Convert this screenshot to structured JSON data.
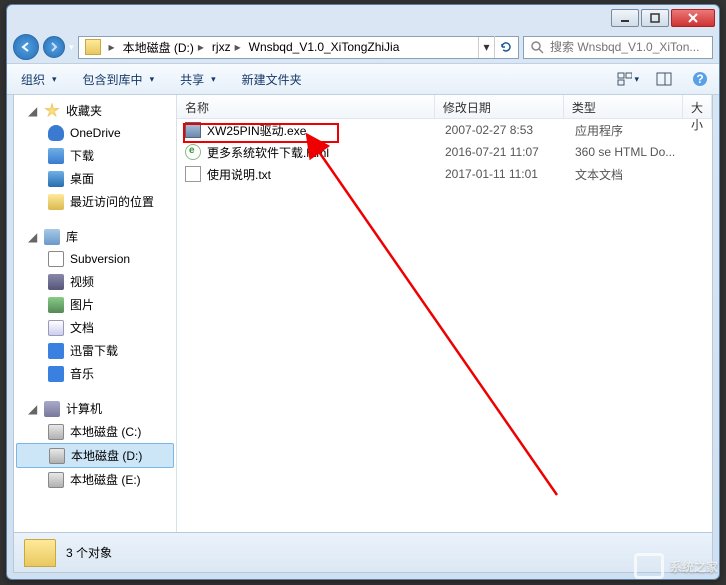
{
  "address": {
    "crumbs": [
      "本地磁盘 (D:)",
      "rjxz",
      "Wnsbqd_V1.0_XiTongZhiJia"
    ]
  },
  "search": {
    "placeholder": "搜索 Wnsbqd_V1.0_XiTon..."
  },
  "toolbar": {
    "organize": "组织",
    "include": "包含到库中",
    "share": "共享",
    "newfolder": "新建文件夹"
  },
  "sidebar": {
    "favorites": {
      "label": "收藏夹",
      "items": [
        "OneDrive",
        "下载",
        "桌面",
        "最近访问的位置"
      ]
    },
    "libraries": {
      "label": "库",
      "items": [
        "Subversion",
        "视频",
        "图片",
        "文档",
        "迅雷下载",
        "音乐"
      ]
    },
    "computer": {
      "label": "计算机",
      "items": [
        "本地磁盘 (C:)",
        "本地磁盘 (D:)",
        "本地磁盘 (E:)"
      ]
    }
  },
  "columns": {
    "name": "名称",
    "date": "修改日期",
    "type": "类型",
    "size": "大小"
  },
  "files": [
    {
      "name": "XW25PIN驱动.exe",
      "date": "2007-02-27 8:53",
      "type": "应用程序",
      "icon": "exe"
    },
    {
      "name": "更多系统软件下载.html",
      "date": "2016-07-21 11:07",
      "type": "360 se HTML Do...",
      "icon": "html"
    },
    {
      "name": "使用说明.txt",
      "date": "2017-01-11 11:01",
      "type": "文本文档",
      "icon": "txt"
    }
  ],
  "status": {
    "count": "3 个对象"
  },
  "watermark": "系统之家"
}
